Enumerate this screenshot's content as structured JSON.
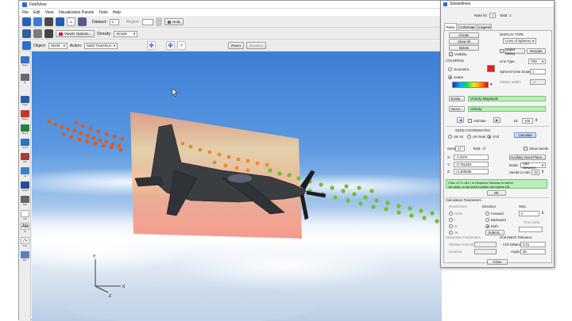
{
  "app": {
    "title": "FieldView"
  },
  "menu": [
    "File",
    "Edit",
    "View",
    "Visualization Panels",
    "Tools",
    "Help"
  ],
  "toolbar1": {
    "dataset_label": "Dataset:",
    "dataset_value": "1",
    "region_label": "Region:",
    "unify_label": "Unify"
  },
  "toolbar2": {
    "viewer_options_label": "Viewer Options...",
    "density_label": "Density:",
    "density_value": "Simple"
  },
  "toolbar3": {
    "object_label": "Object:",
    "object_value": "World",
    "action_label": "Action:",
    "action_value": "Multi-Transform",
    "reset_label": "Reset",
    "deselect_label": "Deselect"
  },
  "left_toolbar_labels": [
    "Reset",
    "Fit",
    "Probe",
    "Stream",
    "Bound",
    "Vector",
    "Part",
    "Iso",
    "Surface",
    "Path",
    "Plot",
    "Ab",
    "Form",
    "Misc"
  ],
  "viewport": {
    "axis_labels": [
      "Y",
      "X",
      "Z"
    ]
  },
  "dialog": {
    "title": "Streamlines",
    "rake_id_label": "Rake ID:",
    "rake_id_value": "1",
    "total_label": "Total:",
    "total_value": "1",
    "tabs": [
      "Rake",
      "Colormap",
      "Legend"
    ],
    "rake_buttons": [
      "Create",
      "Clear All",
      "Delete"
    ],
    "visibility_label": "Visibility",
    "display_type_label": "DISPLAY TYPE",
    "display_type_value": "Lines of Spheres",
    "scalar_sizing_label": "Scalar Sizing",
    "rescale_label": "Rescale",
    "coloring_label": "COLORING",
    "geometric_label": "Geometric",
    "scalar_label": "Scalar",
    "line_type_label": "Line Type:",
    "line_type_value": "Thin",
    "sphere_scale_label": "Sphere/Arrow Scale:",
    "sphere_scale_value": "1",
    "ribbon_width_label": "Ribbon Width:",
    "ribbon_width_value": "10",
    "scalar_button": "Scalar...",
    "scalar_func": "Velocity Magnitude",
    "vector_button": "Vector...",
    "vector_func": "Velocity",
    "animate_label": "Animate",
    "dt_label": "Dt:",
    "dt_value": "100",
    "seed_coords_label": "SEED COORDINATES",
    "seed_ijk_int": "IJK Int",
    "seed_ijk_real": "IJK Real",
    "seed_xyz": "XYZ",
    "calculate_label": "Calculate",
    "seed_label": "Seed:",
    "seed_value": "17",
    "total2_label": "Total:",
    "total2_value": "17",
    "show_seeds_label": "Show Seeds",
    "x_label": "X:",
    "x_value": "-1.0074",
    "y_label": "Y:",
    "y_value": "-0.751393",
    "z_label": "Z:",
    "z_value": "-0.405699",
    "aux_seed_plane_label": "Auxiliary Seed Plane...",
    "mode_label": "Mode:",
    "mode_value": "Add Between",
    "seeds_to_add_label": "Seeds to Add:",
    "seeds_to_add_value": "15",
    "instruction_line1": "Click <CTL-M1> in Graphics Window to select",
    "instruction_line2": "1st seed, or set seed number and press OK.",
    "ok_label": "OK",
    "calc_params_label": "Calculation Parameters",
    "restrictions_label": "Restrictions",
    "restrictions": [
      "None",
      "I",
      "IK",
      "JK"
    ],
    "direction_label": "Direction",
    "directions": [
      "Forward",
      "Backward",
      "Both"
    ],
    "submit_label": "Submit...",
    "step_label": "Step",
    "step_value": "2",
    "time_limit_label": "Time Limit:",
    "streamline_params_label": "Streamline Parameters",
    "release_interval_label": "Release Interval:",
    "duration_label": "Duration:",
    "grid_match_label": "Grid Match Tolerance",
    "cell_distance_label": "Cell Distance:",
    "cell_distance_value": "0.01",
    "angle_label": "Angle:",
    "angle_value": "45",
    "close_label": "Close"
  },
  "colors": {
    "accent": "#1d58c4",
    "scalar_swatch": "#e62117",
    "function_field": "#b8f0b8"
  }
}
